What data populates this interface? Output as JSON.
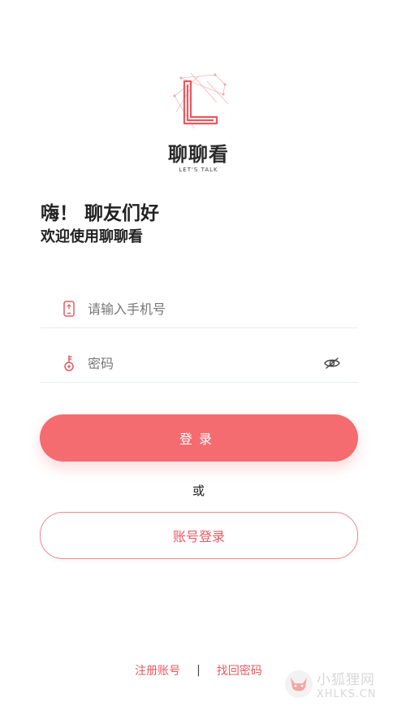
{
  "logo": {
    "title": "聊聊看",
    "tagline": "LET'S TALK"
  },
  "greeting": {
    "line1": "嗨！ 聊友们好",
    "line2": "欢迎使用聊聊看"
  },
  "form": {
    "phone_placeholder": "请输入手机号",
    "password_placeholder": "密码"
  },
  "buttons": {
    "login_label": "登录",
    "or_text": "或",
    "account_login_label": "账号登录"
  },
  "footer": {
    "register_label": "注册账号",
    "separator": "|",
    "recover_label": "找回密码"
  },
  "watermark": {
    "name": "小狐狸网",
    "domain": "XHLKS.CN"
  },
  "colors": {
    "accent": "#f46b70",
    "accent_text": "#e8595f",
    "divider": "#e8ecec"
  }
}
